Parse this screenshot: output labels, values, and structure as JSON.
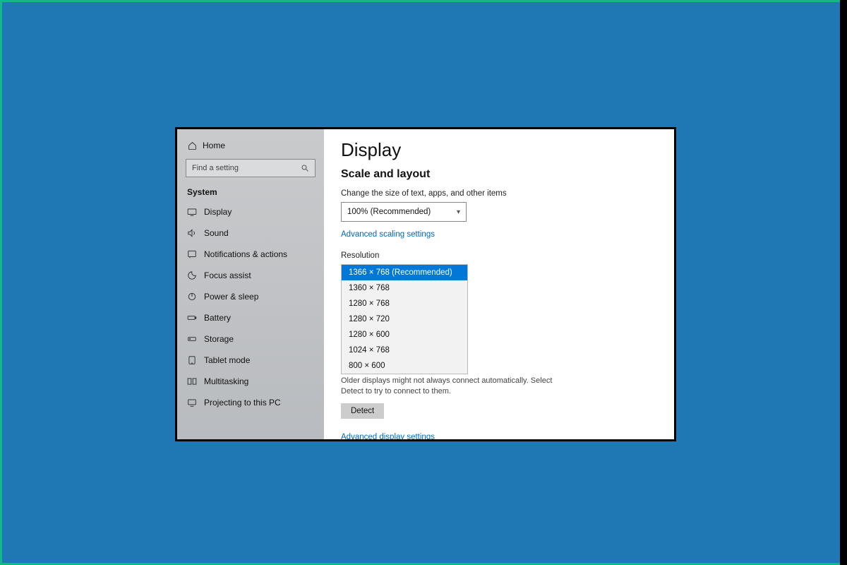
{
  "sidebar": {
    "home": "Home",
    "search_placeholder": "Find a setting",
    "section": "System",
    "items": [
      {
        "label": "Display"
      },
      {
        "label": "Sound"
      },
      {
        "label": "Notifications & actions"
      },
      {
        "label": "Focus assist"
      },
      {
        "label": "Power & sleep"
      },
      {
        "label": "Battery"
      },
      {
        "label": "Storage"
      },
      {
        "label": "Tablet mode"
      },
      {
        "label": "Multitasking"
      },
      {
        "label": "Projecting to this PC"
      }
    ]
  },
  "main": {
    "title": "Display",
    "subtitle": "Scale and layout",
    "scale_label": "Change the size of text, apps, and other items",
    "scale_value": "100% (Recommended)",
    "adv_scaling": "Advanced scaling settings",
    "resolution_label": "Resolution",
    "resolutions": {
      "r0": "1366 × 768 (Recommended)",
      "r1": "1360 × 768",
      "r2": "1280 × 768",
      "r3": "1280 × 720",
      "r4": "1280 × 600",
      "r5": "1024 × 768",
      "r6": "800 × 600"
    },
    "detect_text": "Older displays might not always connect automatically. Select Detect to try to connect to them.",
    "detect_btn": "Detect",
    "adv_display": "Advanced display settings"
  }
}
